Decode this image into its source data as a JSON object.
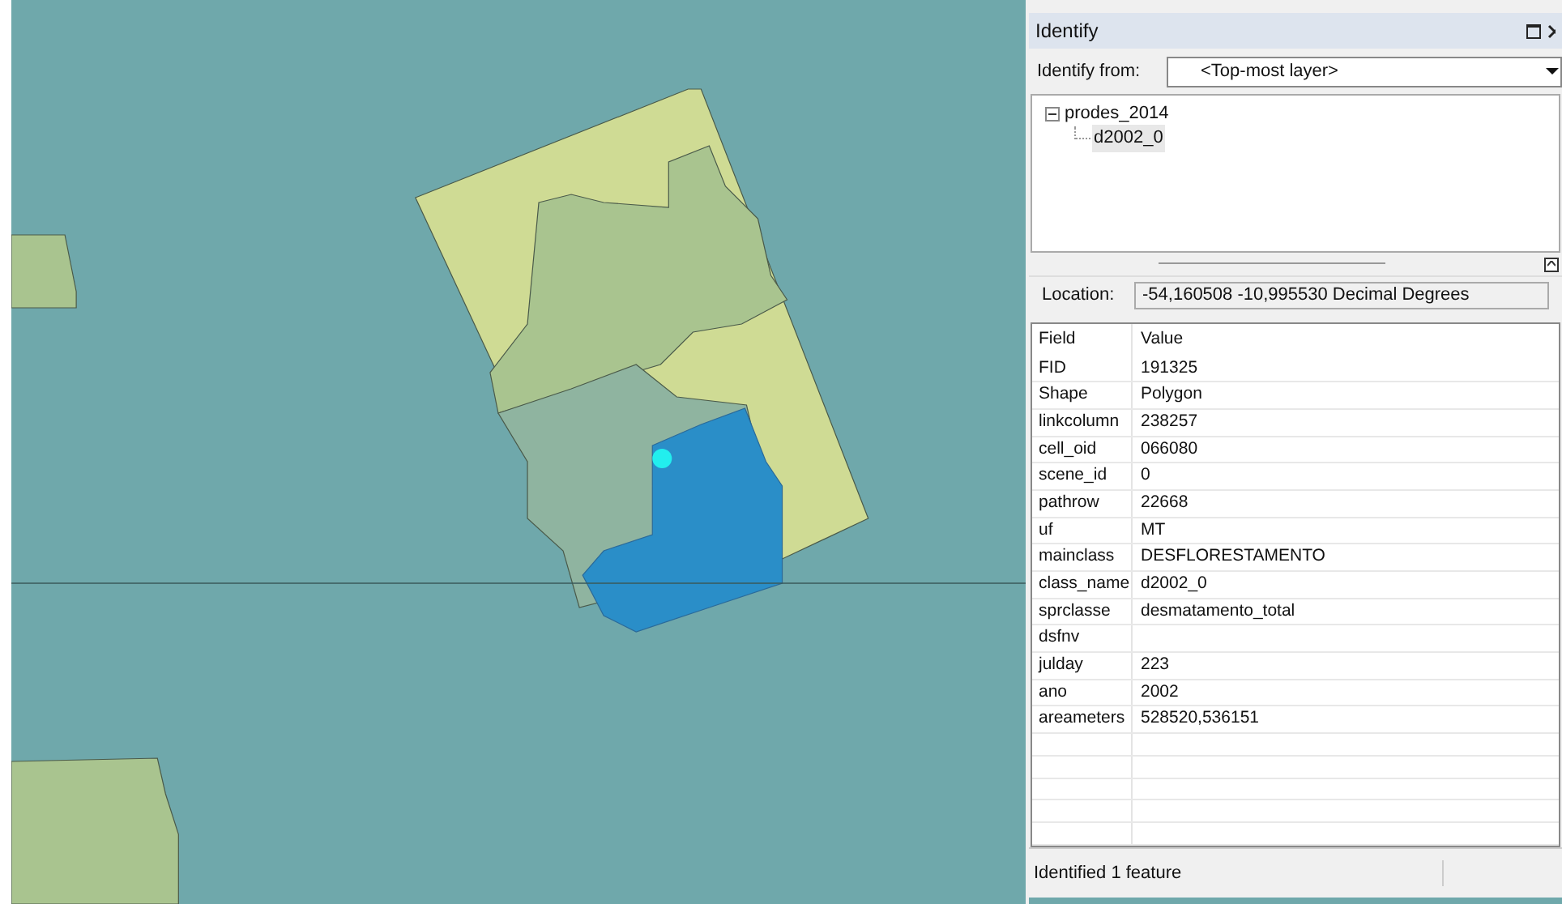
{
  "window": {
    "title": "Identify"
  },
  "identify_from": {
    "label": "Identify from:",
    "value": "<Top-most layer>"
  },
  "tree": [
    {
      "label": "prodes_2014",
      "expanded": true,
      "selected": false,
      "children": [
        {
          "label": "d2002_0",
          "selected": true
        }
      ]
    }
  ],
  "location": {
    "label": "Location:",
    "value": "-54,160508  -10,995530 Decimal Degrees"
  },
  "table": {
    "columns": [
      "Field",
      "Value"
    ],
    "rows": [
      [
        "FID",
        "191325"
      ],
      [
        "Shape",
        "Polygon"
      ],
      [
        "linkcolumn",
        "238257"
      ],
      [
        "cell_oid",
        "066080"
      ],
      [
        "scene_id",
        "0"
      ],
      [
        "pathrow",
        "22668"
      ],
      [
        "uf",
        "MT"
      ],
      [
        "mainclass",
        "DESFLORESTAMENTO"
      ],
      [
        "class_name",
        "d2002_0"
      ],
      [
        "sprclasse",
        "desmatamento_total"
      ],
      [
        "dsfnv"
      ],
      [
        "julday",
        "223"
      ],
      [
        "ano",
        "2002"
      ],
      [
        "areameters",
        "528520,536151"
      ]
    ]
  },
  "status_bar": "Identified 1 feature"
}
